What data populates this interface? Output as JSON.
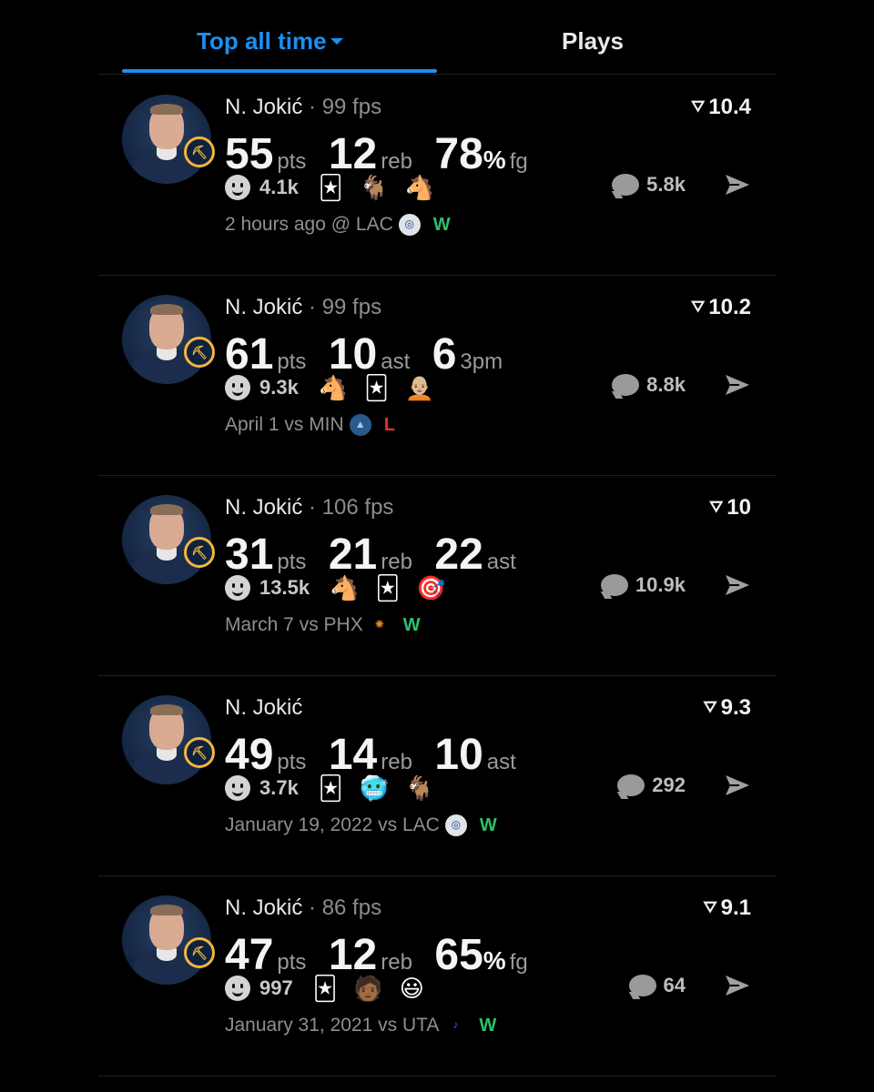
{
  "tabs": {
    "active_label": "Top all time",
    "inactive_label": "Plays"
  },
  "colors": {
    "accent": "#1d8ff0",
    "win": "#2fbf6a",
    "loss": "#e0302f"
  },
  "plays": [
    {
      "player": "N. Jokić",
      "fps": " · 99 fps",
      "rating": "10.4",
      "stats": [
        {
          "num": "55",
          "unit": "pts"
        },
        {
          "num": "12",
          "unit": "reb"
        },
        {
          "num": "78",
          "pct": "%",
          "unit": "fg"
        }
      ],
      "reactions": "4.1k",
      "emojis": [
        "🃏",
        "🐐",
        "🐴"
      ],
      "comments": "5.8k",
      "time": "2 hours ago @ LAC",
      "opponent": "LAC",
      "result": "W"
    },
    {
      "player": "N. Jokić",
      "fps": " · 99 fps",
      "rating": "10.2",
      "stats": [
        {
          "num": "61",
          "unit": "pts"
        },
        {
          "num": "10",
          "unit": "ast"
        },
        {
          "num": "6",
          "unit": "3pm"
        }
      ],
      "reactions": "9.3k",
      "emojis": [
        "🐴",
        "🃏",
        "🧑🏼‍🦲"
      ],
      "comments": "8.8k",
      "time": "April 1 vs MIN",
      "opponent": "MIN",
      "result": "L"
    },
    {
      "player": "N. Jokić",
      "fps": " · 106 fps",
      "rating": "10",
      "stats": [
        {
          "num": "31",
          "unit": "pts"
        },
        {
          "num": "21",
          "unit": "reb"
        },
        {
          "num": "22",
          "unit": "ast"
        }
      ],
      "reactions": "13.5k",
      "emojis": [
        "🐴",
        "🃏",
        "🎯"
      ],
      "comments": "10.9k",
      "time": "March 7 vs PHX",
      "opponent": "PHX",
      "result": "W"
    },
    {
      "player": "N. Jokić",
      "fps": "",
      "rating": "9.3",
      "stats": [
        {
          "num": "49",
          "unit": "pts"
        },
        {
          "num": "14",
          "unit": "reb"
        },
        {
          "num": "10",
          "unit": "ast"
        }
      ],
      "reactions": "3.7k",
      "emojis": [
        "🃏",
        "🥶",
        "🐐"
      ],
      "comments": "292",
      "time": "January 19, 2022 vs LAC",
      "opponent": "LAC",
      "result": "W"
    },
    {
      "player": "N. Jokić",
      "fps": " · 86 fps",
      "rating": "9.1",
      "stats": [
        {
          "num": "47",
          "unit": "pts"
        },
        {
          "num": "12",
          "unit": "reb"
        },
        {
          "num": "65",
          "pct": "%",
          "unit": "fg"
        }
      ],
      "reactions": "997",
      "emojis": [
        "🃏",
        "🧑🏾",
        "😃"
      ],
      "comments": "64",
      "time": "January 31, 2021 vs UTA",
      "opponent": "UTA",
      "result": "W"
    }
  ]
}
